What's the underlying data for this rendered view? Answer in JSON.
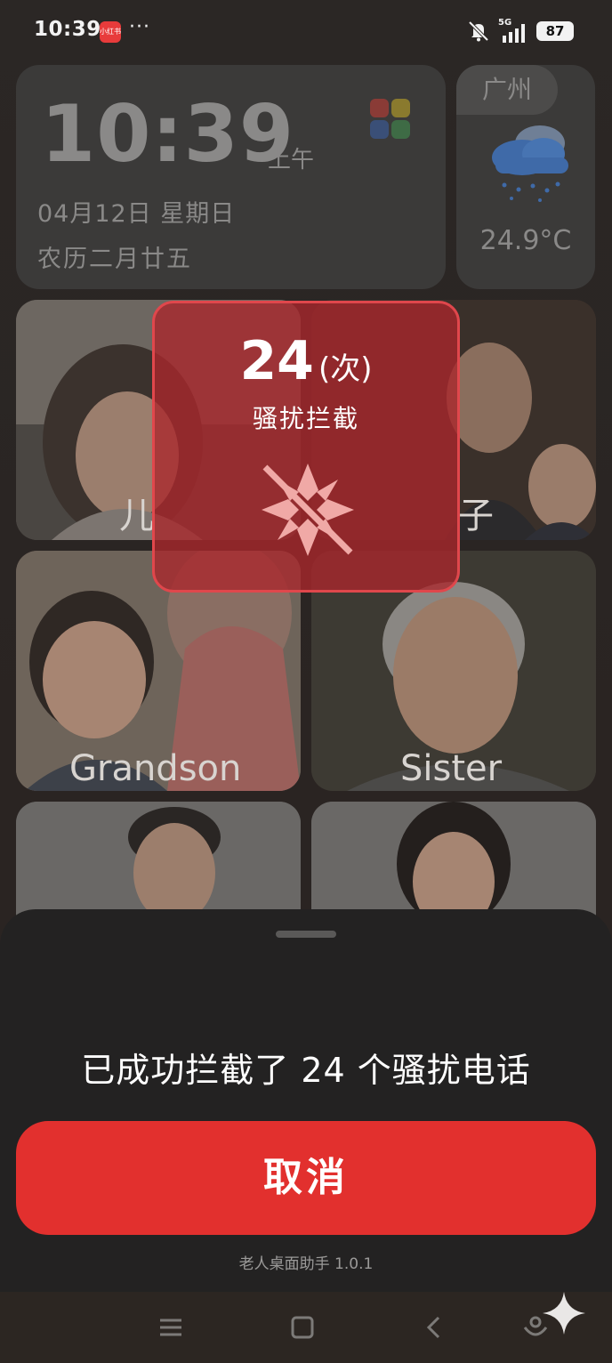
{
  "status_bar": {
    "time": "10:39",
    "app_badge": "小红书",
    "overflow": "···",
    "network": "5G",
    "battery": "87"
  },
  "clock_widget": {
    "time": "10:39",
    "ampm": "上午",
    "date": "04月12日  星期日",
    "lunar": "农历二月廿五"
  },
  "weather_widget": {
    "city": "广州",
    "icon": "rain-cloud-icon",
    "temperature": "24.9°C"
  },
  "contacts": [
    {
      "label": "儿"
    },
    {
      "label": "子"
    },
    {
      "label": "Grandson"
    },
    {
      "label": "Sister"
    },
    {
      "label": ""
    },
    {
      "label": ""
    }
  ],
  "popup": {
    "count": "24",
    "unit": "(次)",
    "title": "骚扰拦截",
    "icon": "block-shield-icon",
    "accent": "#e0474c"
  },
  "sheet": {
    "message": "已成功拦截了 24 个骚扰电话",
    "cancel_label": "取消",
    "version": "老人桌面助手 1.0.1",
    "button_color": "#e2302e"
  },
  "navbar": {
    "icons": [
      "menu-icon",
      "home-icon",
      "back-icon",
      "assistant-icon"
    ]
  }
}
